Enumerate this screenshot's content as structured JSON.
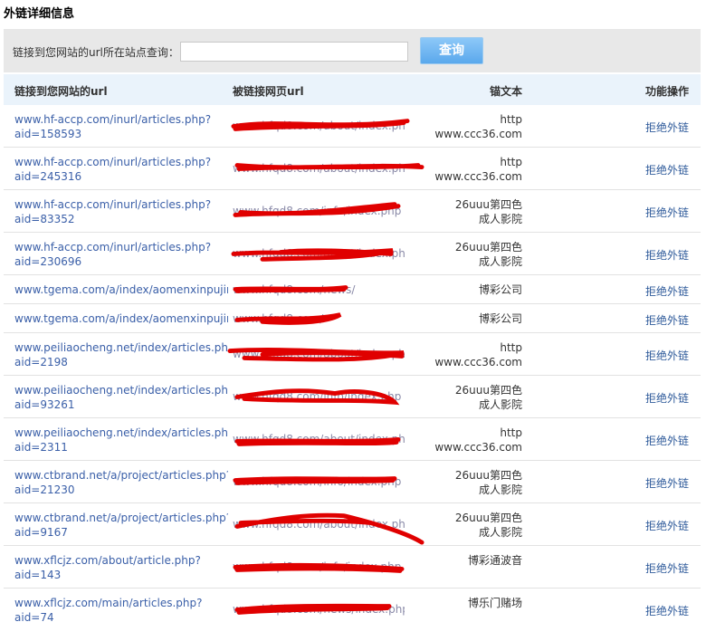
{
  "page": {
    "title": "外链详细信息"
  },
  "search": {
    "label": "链接到您网站的url所在站点查询：",
    "value": "",
    "placeholder": "",
    "button_label": "查询"
  },
  "table": {
    "headers": {
      "url": "链接到您网站的url",
      "page": "被链接网页url",
      "anchor": "锚文本",
      "ops": "功能操作"
    },
    "rows": [
      {
        "url1": "www.hf-accp.com/inurl/articles.php?",
        "url2": "aid=158593",
        "page": "www.hfqd8.com/about/index.php",
        "anchor1": "http",
        "anchor2": "www.ccc36.com",
        "op": "拒绝外链"
      },
      {
        "url1": "www.hf-accp.com/inurl/articles.php?",
        "url2": "aid=245316",
        "page": "www.hfqd8.com/about/index.php",
        "anchor1": "http",
        "anchor2": "www.ccc36.com",
        "op": "拒绝外链"
      },
      {
        "url1": "www.hf-accp.com/inurl/articles.php?",
        "url2": "aid=83352",
        "page": "www.hfqd8.com/info/index.php",
        "anchor1": "26uuu第四色",
        "anchor2": "成人影院",
        "op": "拒绝外链"
      },
      {
        "url1": "www.hf-accp.com/inurl/articles.php?",
        "url2": "aid=230696",
        "page": "www.hfqd8.com/about/index.php",
        "anchor1": "26uuu第四色",
        "anchor2": "成人影院",
        "op": "拒绝外链"
      },
      {
        "url1": "www.tgema.com/a/index/aomenxinpujingc",
        "url2": "",
        "page": "www.hfqd8.com/news/",
        "anchor1": "博彩公司",
        "anchor2": "",
        "op": "拒绝外链"
      },
      {
        "url1": "www.tgema.com/a/index/aomenxinpujingc",
        "url2": "",
        "page": "www.hfqd8.com/",
        "anchor1": "博彩公司",
        "anchor2": "",
        "op": "拒绝外链"
      },
      {
        "url1": "www.peiliaocheng.net/index/articles.php?",
        "url2": "aid=2198",
        "page": "www.hfqd8.com/about/index.php",
        "anchor1": "http",
        "anchor2": "www.ccc36.com",
        "op": "拒绝外链"
      },
      {
        "url1": "www.peiliaocheng.net/index/articles.php?",
        "url2": "aid=93261",
        "page": "www.hfqd8.com/info/index.php",
        "anchor1": "26uuu第四色",
        "anchor2": "成人影院",
        "op": "拒绝外链"
      },
      {
        "url1": "www.peiliaocheng.net/index/articles.php?",
        "url2": "aid=2311",
        "page": "www.hfqd8.com/about/index.php",
        "anchor1": "http",
        "anchor2": "www.ccc36.com",
        "op": "拒绝外链"
      },
      {
        "url1": "www.ctbrand.net/a/project/articles.php?",
        "url2": "aid=21230",
        "page": "www.hfqd8.com/info/index.php",
        "anchor1": "26uuu第四色",
        "anchor2": "成人影院",
        "op": "拒绝外链"
      },
      {
        "url1": "www.ctbrand.net/a/project/articles.php?",
        "url2": "aid=9167",
        "page": "www.hfqd8.com/about/index.php",
        "anchor1": "26uuu第四色",
        "anchor2": "成人影院",
        "op": "拒绝外链"
      },
      {
        "url1": "www.xflcjz.com/about/article.php?",
        "url2": "aid=143",
        "page": "www.hfqd8.com/info/index.php",
        "anchor1": "博彩通波音",
        "anchor2": "",
        "op": "拒绝外链"
      },
      {
        "url1": "www.xflcjz.com/main/articles.php?",
        "url2": "aid=74",
        "page": "www.hfqd8.com/news/index.php",
        "anchor1": "博乐门赌场",
        "anchor2": "",
        "op": "拒绝外链"
      }
    ]
  },
  "colors": {
    "link": "#3a5fa8",
    "header_bg": "#eaf3fb",
    "search_bg": "#e8e8e8",
    "button": "#5aa8ec",
    "scribble": "#e00000"
  }
}
